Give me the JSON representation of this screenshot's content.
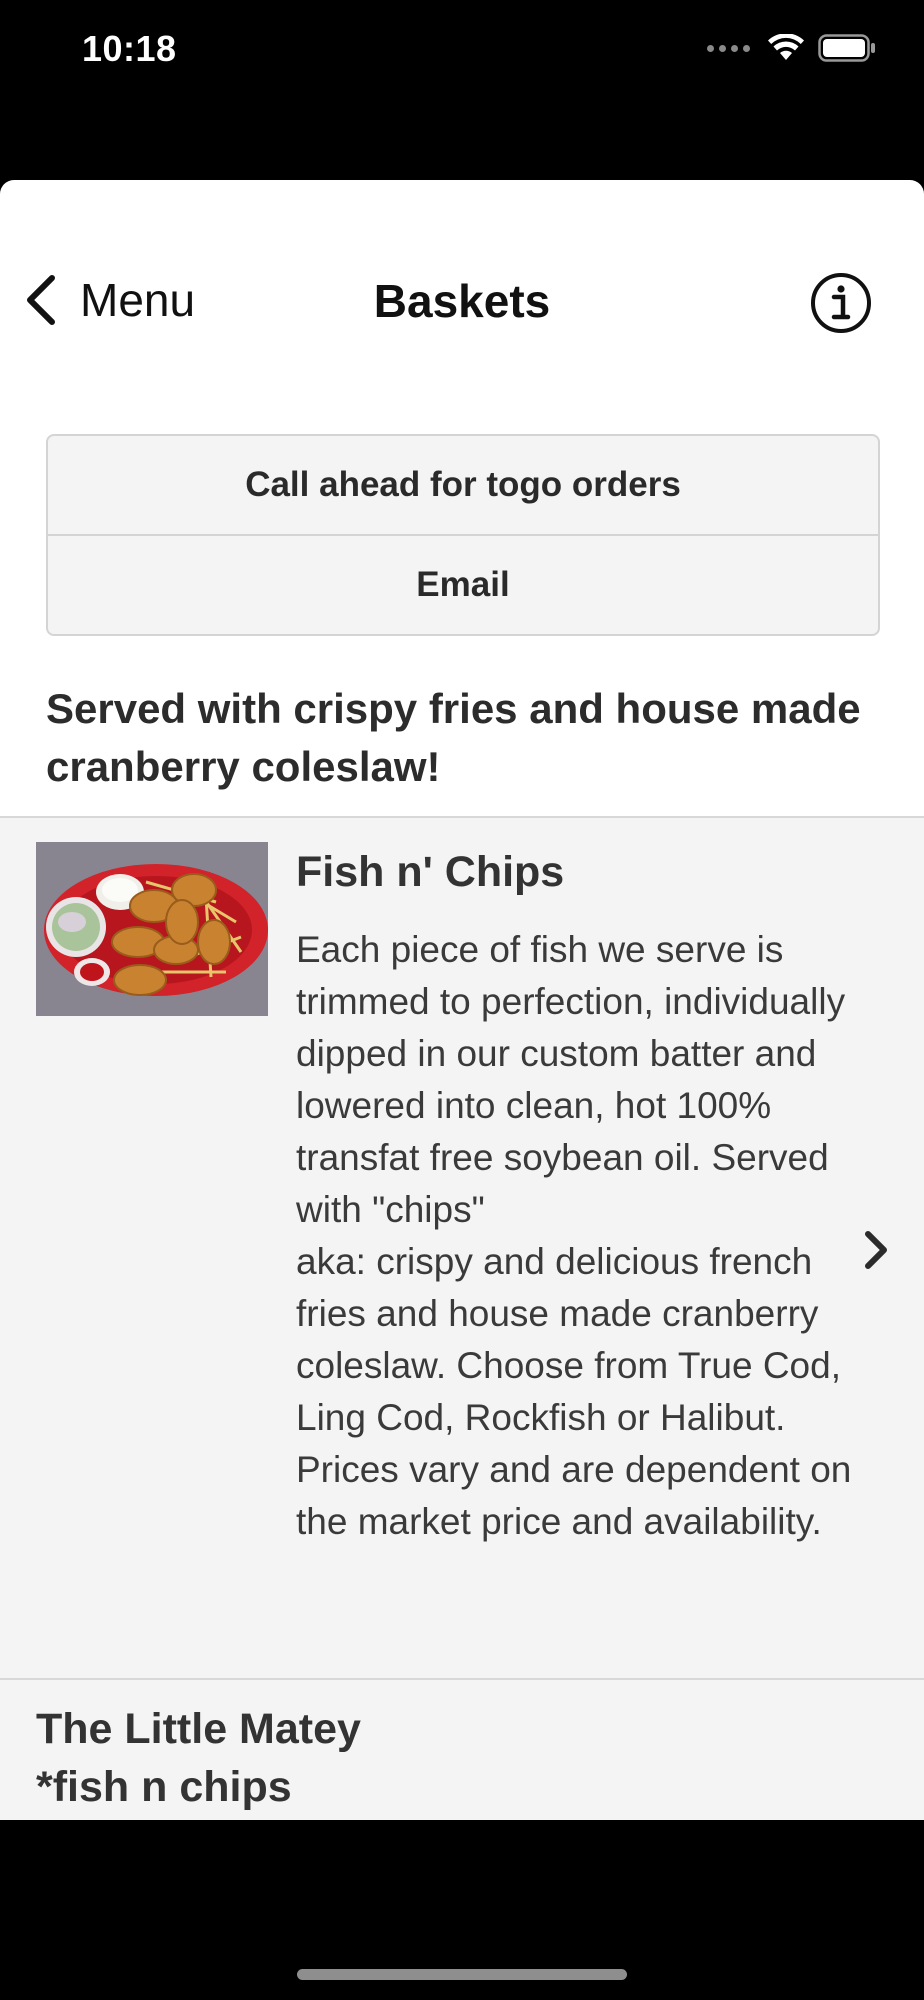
{
  "status_bar": {
    "time": "10:18"
  },
  "nav": {
    "back_label": "Menu",
    "title": "Baskets",
    "info_icon": "info-circle-icon"
  },
  "actions": [
    {
      "label": "Call ahead for togo orders"
    },
    {
      "label": "Email"
    }
  ],
  "intro": "Served with crispy fries and house made cranberry coleslaw!",
  "items": [
    {
      "title": "Fish n' Chips",
      "description": "Each piece of fish we serve is trimmed to perfection, individually dipped in our custom batter and lowered into clean, hot 100% transfat free soybean oil. Served with \"chips\"\naka: crispy and delicious french fries and house made cranberry coleslaw. Choose from True Cod, Ling Cod, Rockfish or Halibut. Prices vary and are dependent on the market price and availability."
    },
    {
      "title": "The Little Matey\n*fish n chips"
    }
  ],
  "colors": {
    "background": "#000000",
    "sheet": "#ffffff",
    "list_bg": "#f4f4f4",
    "divider": "#d8d8d8",
    "text_dark": "#2c2c2c"
  }
}
